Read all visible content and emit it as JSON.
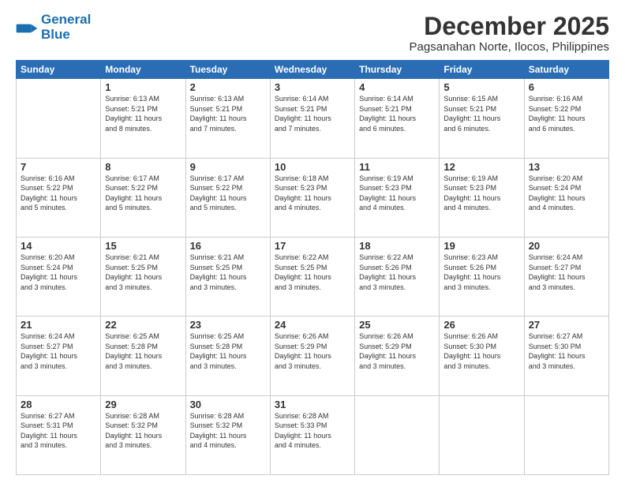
{
  "header": {
    "logo_line1": "General",
    "logo_line2": "Blue",
    "title": "December 2025",
    "subtitle": "Pagsanahan Norte, Ilocos, Philippines"
  },
  "days_of_week": [
    "Sunday",
    "Monday",
    "Tuesday",
    "Wednesday",
    "Thursday",
    "Friday",
    "Saturday"
  ],
  "weeks": [
    [
      {
        "day": "",
        "info": ""
      },
      {
        "day": "1",
        "info": "Sunrise: 6:13 AM\nSunset: 5:21 PM\nDaylight: 11 hours\nand 8 minutes."
      },
      {
        "day": "2",
        "info": "Sunrise: 6:13 AM\nSunset: 5:21 PM\nDaylight: 11 hours\nand 7 minutes."
      },
      {
        "day": "3",
        "info": "Sunrise: 6:14 AM\nSunset: 5:21 PM\nDaylight: 11 hours\nand 7 minutes."
      },
      {
        "day": "4",
        "info": "Sunrise: 6:14 AM\nSunset: 5:21 PM\nDaylight: 11 hours\nand 6 minutes."
      },
      {
        "day": "5",
        "info": "Sunrise: 6:15 AM\nSunset: 5:21 PM\nDaylight: 11 hours\nand 6 minutes."
      },
      {
        "day": "6",
        "info": "Sunrise: 6:16 AM\nSunset: 5:22 PM\nDaylight: 11 hours\nand 6 minutes."
      }
    ],
    [
      {
        "day": "7",
        "info": "Sunrise: 6:16 AM\nSunset: 5:22 PM\nDaylight: 11 hours\nand 5 minutes."
      },
      {
        "day": "8",
        "info": "Sunrise: 6:17 AM\nSunset: 5:22 PM\nDaylight: 11 hours\nand 5 minutes."
      },
      {
        "day": "9",
        "info": "Sunrise: 6:17 AM\nSunset: 5:22 PM\nDaylight: 11 hours\nand 5 minutes."
      },
      {
        "day": "10",
        "info": "Sunrise: 6:18 AM\nSunset: 5:23 PM\nDaylight: 11 hours\nand 4 minutes."
      },
      {
        "day": "11",
        "info": "Sunrise: 6:19 AM\nSunset: 5:23 PM\nDaylight: 11 hours\nand 4 minutes."
      },
      {
        "day": "12",
        "info": "Sunrise: 6:19 AM\nSunset: 5:23 PM\nDaylight: 11 hours\nand 4 minutes."
      },
      {
        "day": "13",
        "info": "Sunrise: 6:20 AM\nSunset: 5:24 PM\nDaylight: 11 hours\nand 4 minutes."
      }
    ],
    [
      {
        "day": "14",
        "info": "Sunrise: 6:20 AM\nSunset: 5:24 PM\nDaylight: 11 hours\nand 3 minutes."
      },
      {
        "day": "15",
        "info": "Sunrise: 6:21 AM\nSunset: 5:25 PM\nDaylight: 11 hours\nand 3 minutes."
      },
      {
        "day": "16",
        "info": "Sunrise: 6:21 AM\nSunset: 5:25 PM\nDaylight: 11 hours\nand 3 minutes."
      },
      {
        "day": "17",
        "info": "Sunrise: 6:22 AM\nSunset: 5:25 PM\nDaylight: 11 hours\nand 3 minutes."
      },
      {
        "day": "18",
        "info": "Sunrise: 6:22 AM\nSunset: 5:26 PM\nDaylight: 11 hours\nand 3 minutes."
      },
      {
        "day": "19",
        "info": "Sunrise: 6:23 AM\nSunset: 5:26 PM\nDaylight: 11 hours\nand 3 minutes."
      },
      {
        "day": "20",
        "info": "Sunrise: 6:24 AM\nSunset: 5:27 PM\nDaylight: 11 hours\nand 3 minutes."
      }
    ],
    [
      {
        "day": "21",
        "info": "Sunrise: 6:24 AM\nSunset: 5:27 PM\nDaylight: 11 hours\nand 3 minutes."
      },
      {
        "day": "22",
        "info": "Sunrise: 6:25 AM\nSunset: 5:28 PM\nDaylight: 11 hours\nand 3 minutes."
      },
      {
        "day": "23",
        "info": "Sunrise: 6:25 AM\nSunset: 5:28 PM\nDaylight: 11 hours\nand 3 minutes."
      },
      {
        "day": "24",
        "info": "Sunrise: 6:26 AM\nSunset: 5:29 PM\nDaylight: 11 hours\nand 3 minutes."
      },
      {
        "day": "25",
        "info": "Sunrise: 6:26 AM\nSunset: 5:29 PM\nDaylight: 11 hours\nand 3 minutes."
      },
      {
        "day": "26",
        "info": "Sunrise: 6:26 AM\nSunset: 5:30 PM\nDaylight: 11 hours\nand 3 minutes."
      },
      {
        "day": "27",
        "info": "Sunrise: 6:27 AM\nSunset: 5:30 PM\nDaylight: 11 hours\nand 3 minutes."
      }
    ],
    [
      {
        "day": "28",
        "info": "Sunrise: 6:27 AM\nSunset: 5:31 PM\nDaylight: 11 hours\nand 3 minutes."
      },
      {
        "day": "29",
        "info": "Sunrise: 6:28 AM\nSunset: 5:32 PM\nDaylight: 11 hours\nand 3 minutes."
      },
      {
        "day": "30",
        "info": "Sunrise: 6:28 AM\nSunset: 5:32 PM\nDaylight: 11 hours\nand 4 minutes."
      },
      {
        "day": "31",
        "info": "Sunrise: 6:28 AM\nSunset: 5:33 PM\nDaylight: 11 hours\nand 4 minutes."
      },
      {
        "day": "",
        "info": ""
      },
      {
        "day": "",
        "info": ""
      },
      {
        "day": "",
        "info": ""
      }
    ]
  ]
}
